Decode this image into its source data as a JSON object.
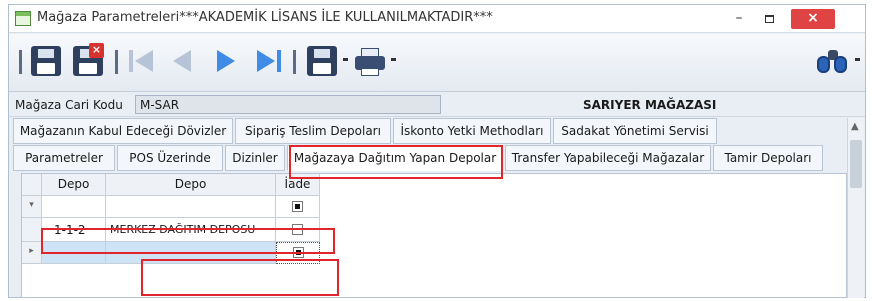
{
  "window": {
    "title": "Mağaza Parametreleri***AKADEMİK LİSANS İLE KULLANILMAKTADIR***",
    "minimize_label": "–",
    "close_label": "×"
  },
  "header": {
    "code_label": "Mağaza Cari Kodu",
    "code_value": "M-SAR",
    "store_name": "SARIYER MAĞAZASI"
  },
  "tabs_row1": [
    {
      "label": "Mağazanın Kabul Edeceği Dövizler"
    },
    {
      "label": "Sipariş Teslim Depoları"
    },
    {
      "label": "İskonto Yetki Methodları"
    },
    {
      "label": "Sadakat Yönetimi Servisi"
    }
  ],
  "tabs_row2": [
    {
      "label": "Parametreler"
    },
    {
      "label": "POS Üzerinde"
    },
    {
      "label": "Dizinler"
    },
    {
      "label": "Mağazaya Dağıtım Yapan Depolar",
      "active": true
    },
    {
      "label": "Transfer Yapabileceği Mağazalar"
    },
    {
      "label": "Tamir Depoları"
    }
  ],
  "grid": {
    "columns": [
      "Depo",
      "Depo",
      "İade"
    ],
    "filter_row_glyph": "▾",
    "current_row_glyph": "▸",
    "rows": [
      {
        "code": "1-1-2",
        "name": "MERKEZ DAĞITIM DEPOSU",
        "iade": false
      },
      {
        "code": "",
        "name": "",
        "iade": true
      }
    ],
    "filter_iade": true
  },
  "icons": {
    "save": "save-icon",
    "save_close": "save-close-icon",
    "first": "first-record-icon",
    "prev": "previous-record-icon",
    "next": "next-record-icon",
    "last": "last-record-icon",
    "export": "export-icon",
    "print": "printer-icon",
    "search": "binoculars-icon"
  },
  "colors": {
    "close_button": "#e04343",
    "highlight": "#e1252b",
    "selected_row": "#cfe3f7",
    "nav_active": "#3f8be6"
  }
}
